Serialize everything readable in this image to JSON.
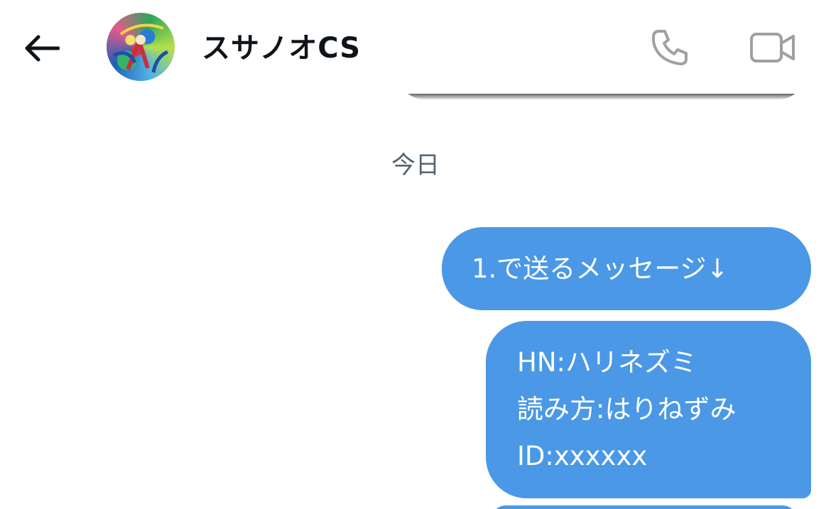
{
  "header": {
    "contact_name": "スサノオCS",
    "back_icon": "arrow-left-icon",
    "call_icon": "phone-icon",
    "video_icon": "video-camera-icon"
  },
  "conversation": {
    "date_separator": "今日",
    "messages": [
      {
        "sender": "me",
        "lines": [
          "1.で送るメッセージ↓"
        ]
      },
      {
        "sender": "me",
        "lines": [
          "HN:ハリネズミ",
          "読み方:はりねずみ",
          "ID:xxxxxx"
        ]
      }
    ]
  },
  "colors": {
    "bubble_background": "#4a98e6",
    "bubble_text": "#ffffff",
    "header_text": "#0f1419",
    "date_text": "#536471",
    "icon_gray": "#a0a0a0"
  }
}
